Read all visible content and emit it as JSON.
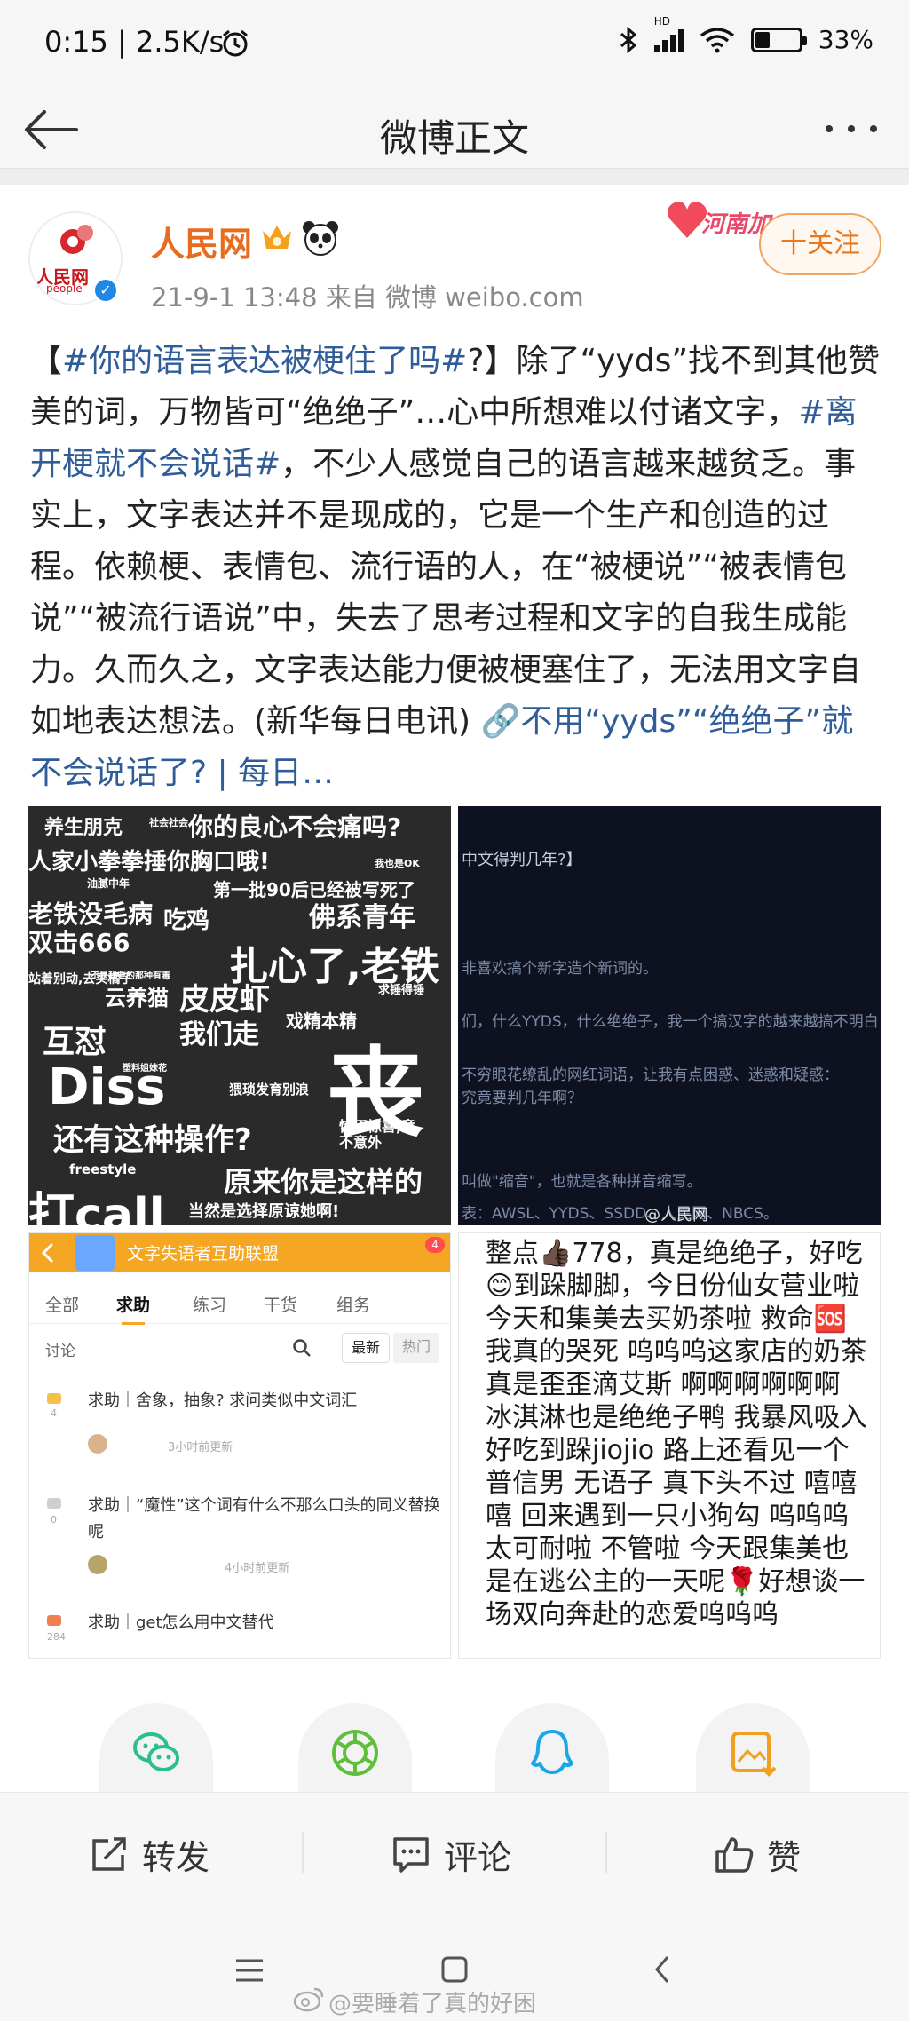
{
  "status_bar": {
    "time_speed": "0:15 | 2.5K/s",
    "battery": "33%",
    "battery_level": 0.33,
    "hd_label": "HD"
  },
  "nav": {
    "title": "微博正文"
  },
  "post": {
    "username": "人民网",
    "meta": "21-9-1 13:48   来自 微博 weibo.com",
    "follow_label": "十关注",
    "sticker_text": "河南加",
    "avatar_text": "人民网",
    "avatar_sub": "people",
    "body": {
      "p1": "【",
      "tag1": "#你的语言表达被梗住了吗#",
      "p2": "?】除了“yyds”找不到其他赞美的词，万物皆可“绝绝子”…心中所想难以付诸文字，",
      "tag2": "#离开梗就不会说话#",
      "p3": "，不少人感觉自己的语言越来越贫乏。事实上，文字表达并不是现成的，它是一个生产和创造的过程。依赖梗、表情包、流行语的人，在“被梗说”“被表情包说”“被流行语说”中，失去了思考过程和文字的自我生成能力。久而久之，文字表达能力便被梗塞住了，无法用文字自如地表达想法。(新华每日电讯) ",
      "link": "🔗不用“yyds”“绝绝子”就不会说话了? | 每日…"
    }
  },
  "images": {
    "collage_words": [
      "养生朋克",
      "社会社会",
      "你的良心不会痛吗?",
      "人家小拳拳捶你胸口哦!",
      "油腻中年",
      "我也是OK",
      "第一批90后已经被写死了",
      "老铁没毛病",
      "双击666",
      "吃鸡",
      "佛系青年",
      "扎心了,老铁",
      "站着别动,去买橘子",
      "不是我要的那种有毒",
      "云养猫",
      "求锤得锤",
      "皮皮虾",
      "我们走",
      "戏精本精",
      "互怼",
      "丧",
      "Diss",
      "塑料姐妹花",
      "猥琐发育别浪",
      "惊不惊喜,意不意外",
      "还有这种操作?",
      "freestyle",
      "原来你是这样的",
      "打call",
      "当然是选择原谅她啊!"
    ],
    "dark_lines": [
      "中文得判几年?】",
      "非喜欢搞个新字造个新词的。",
      "们，什么YYDS，什么绝绝子，我一个搞汉字的越来越搞不明白",
      "不穷眼花缭乱的网红词语，让我有点困惑、迷惑和疑惑：",
      "究竟要判几年啊？",
      "叫做\"缩音\"，也就是各种拼音缩写。",
      "表：AWSL、YYDS、SSDD、人民网、NBCS。"
    ],
    "dark_watermark": "@人民网",
    "forum": {
      "header": "文字失语者互助联盟",
      "tabs": [
        "全部",
        "求助",
        "练习",
        "干货",
        "组务"
      ],
      "sub": "讨论",
      "sort": [
        "最新",
        "热门"
      ],
      "threads": [
        {
          "title": "求助｜舍象，抽象? 求问类似中文词汇",
          "time": "3小时前更新",
          "count": "4"
        },
        {
          "title": "求助｜“魔性”这个词有什么不那么口头的同义替换呢",
          "time": "4小时前更新",
          "count": "0"
        },
        {
          "title": "求助｜get怎么用中文替代",
          "time": "",
          "count": "284"
        }
      ],
      "notif": "4"
    },
    "text_note": "整点👍🏿778，真是绝绝子，好吃😊到跺脚脚，今日份仙女营业啦 今天和集美去买奶茶啦 救命🆘我真的哭死 呜呜呜这家店的奶茶真是歪歪滴艾斯 啊啊啊啊啊啊 冰淇淋也是绝绝子鸭 我暴风吸入 好吃到跺jiojio 路上还看见一个普信男 无语子 真下头不过 嘻嘻嘻 回来遇到一只小狗勾 呜呜呜太可耐啦 不管啦 今天跟集美也是在逃公主的一天呢🌹好想谈一场双向奔赴的恋爱呜呜呜"
  },
  "share": {
    "items": [
      "wechat-icon",
      "moments-icon",
      "qq-icon",
      "save-image-icon"
    ]
  },
  "actions": {
    "repost": "转发",
    "comment": "评论",
    "like": "赞"
  },
  "watermark": "@要睡着了真的好困",
  "colors": {
    "username": "#e86c1f",
    "link": "#2f5d99",
    "follow": "#e8781f",
    "forum_accent": "#f5a623",
    "share_green": "#2bbf8a",
    "share_qq": "#1aa7e8",
    "share_save": "#f0a020"
  }
}
